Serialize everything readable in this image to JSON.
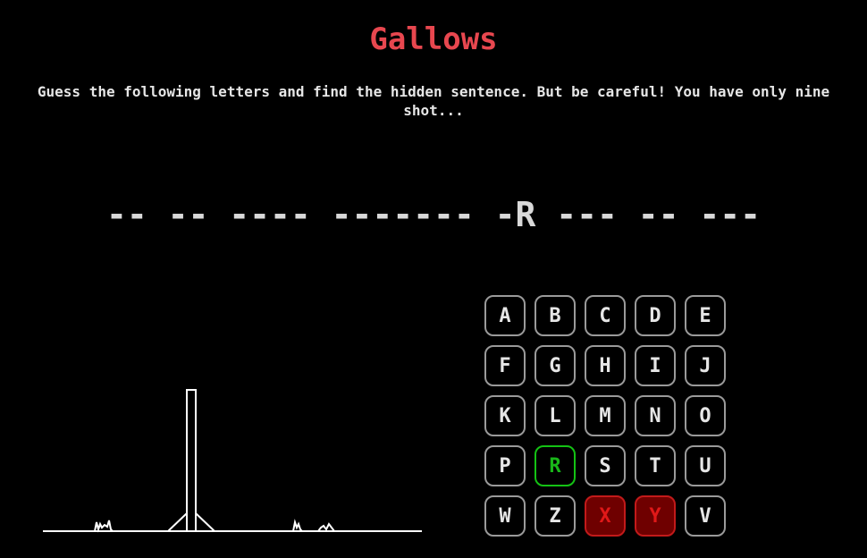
{
  "header": {
    "title": "Gallows",
    "instructions": "Guess the following letters and find the hidden sentence. But be careful! You have only nine shot..."
  },
  "phrase": {
    "display": "-- -- ---- ------- -R --- -- ---"
  },
  "keyboard": {
    "keys": [
      {
        "letter": "A",
        "state": "unused"
      },
      {
        "letter": "B",
        "state": "unused"
      },
      {
        "letter": "C",
        "state": "unused"
      },
      {
        "letter": "D",
        "state": "unused"
      },
      {
        "letter": "E",
        "state": "unused"
      },
      {
        "letter": "F",
        "state": "unused"
      },
      {
        "letter": "G",
        "state": "unused"
      },
      {
        "letter": "H",
        "state": "unused"
      },
      {
        "letter": "I",
        "state": "unused"
      },
      {
        "letter": "J",
        "state": "unused"
      },
      {
        "letter": "K",
        "state": "unused"
      },
      {
        "letter": "L",
        "state": "unused"
      },
      {
        "letter": "M",
        "state": "unused"
      },
      {
        "letter": "N",
        "state": "unused"
      },
      {
        "letter": "O",
        "state": "unused"
      },
      {
        "letter": "P",
        "state": "unused"
      },
      {
        "letter": "R",
        "state": "correct"
      },
      {
        "letter": "S",
        "state": "unused"
      },
      {
        "letter": "T",
        "state": "unused"
      },
      {
        "letter": "U",
        "state": "unused"
      },
      {
        "letter": "W",
        "state": "unused"
      },
      {
        "letter": "Z",
        "state": "unused"
      },
      {
        "letter": "X",
        "state": "wrong"
      },
      {
        "letter": "Y",
        "state": "wrong"
      },
      {
        "letter": "V",
        "state": "unused"
      }
    ]
  },
  "colors": {
    "title": "#e8474f",
    "correct": "#19b619",
    "wrong": "#e01818",
    "wrong_background": "#6f0000",
    "key_border": "#9a9a9a"
  }
}
